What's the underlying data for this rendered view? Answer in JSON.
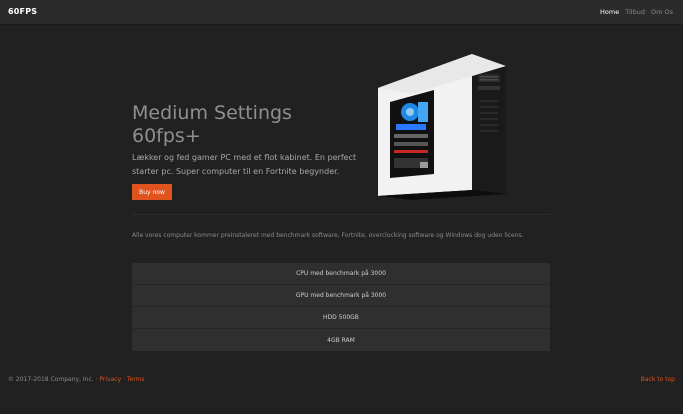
{
  "navbar": {
    "brand": "60FPS",
    "links": [
      "Home",
      "Tilbud",
      "Om Os"
    ]
  },
  "hero": {
    "title_line1": "Medium Settings",
    "title_line2": "60fps+",
    "description": "Lækker og fed gamer PC med et flot kabinet. En perfect starter pc. Super computer til en Fortnite begynder.",
    "button_label": "Buy now"
  },
  "content": {
    "intro": "Alle vores computer kommer preinstaleret med benchmark software, Fortnite, overclocking software og Windows dog uden licens.",
    "specs": [
      "CPU med benchmark på 3000",
      "GPU med benchmark på 3000",
      "HDD 500GB",
      "4GB RAM"
    ]
  },
  "footer": {
    "copyright": "© 2017-2018 Company, Inc. · ",
    "privacy": "Privacy",
    "separator": " · ",
    "terms": "Terms",
    "back_to_top": "Back to top"
  },
  "colors": {
    "accent": "#e0531f",
    "background": "#212121",
    "navbar": "#2b2b2b",
    "panel": "#2f2f2f"
  }
}
